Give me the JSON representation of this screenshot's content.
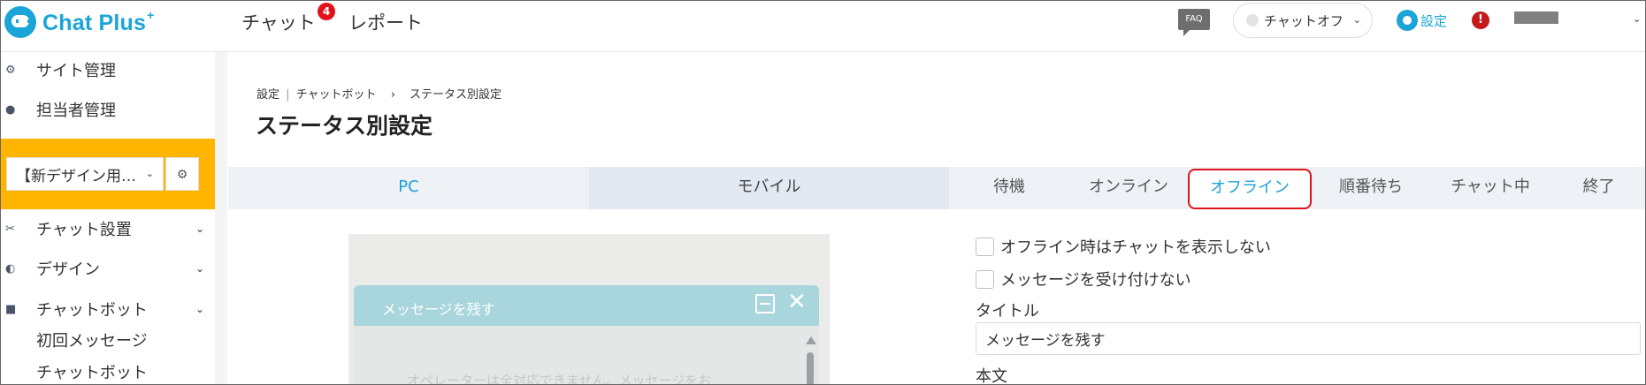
{
  "app": {
    "logo_text": "Chat Plus",
    "logo_sup": "+"
  },
  "topnav": {
    "chat_label": "チャット",
    "chat_badge": "4",
    "report_label": "レポート",
    "faq_label": "FAQ",
    "status_value": "チャットオフ",
    "settings_label": "設定",
    "alert_label": "!"
  },
  "sidebar": {
    "site_management": "サイト管理",
    "staff_management": "担当者管理",
    "site_select_value": "【新デザイン用…",
    "chat_install": "チャット設置",
    "design": "デザイン",
    "chatbot": "チャットボット",
    "chatbot_sub": [
      "初回メッセージ",
      "チャットボット"
    ]
  },
  "breadcrumb": {
    "part1": "設定",
    "sep1": "|",
    "part2": "チャットボット",
    "sep2": "›",
    "part3": "ステータス別設定"
  },
  "page_title": "ステータス別設定",
  "device_tabs": [
    "PC",
    "モバイル"
  ],
  "status_tabs": [
    "待機",
    "オンライン",
    "オフライン",
    "順番待ち",
    "チャット中",
    "終了"
  ],
  "active_status_tab": "オフライン",
  "preview": {
    "header_title": "メッセージを残す",
    "body_text": "オペレーターは全対応できません。メッセージをお"
  },
  "form": {
    "hide_chat_offline": "オフライン時はチャットを表示しない",
    "no_messages": "メッセージを受け付けない",
    "title_label": "タイトル",
    "title_value": "メッセージを残す",
    "body_label": "本文"
  },
  "colors": {
    "accent": "#1ba4d8",
    "warning_panel": "#ffb400",
    "highlight_border": "#e0121b",
    "preview_header": "#a9d6dc"
  }
}
